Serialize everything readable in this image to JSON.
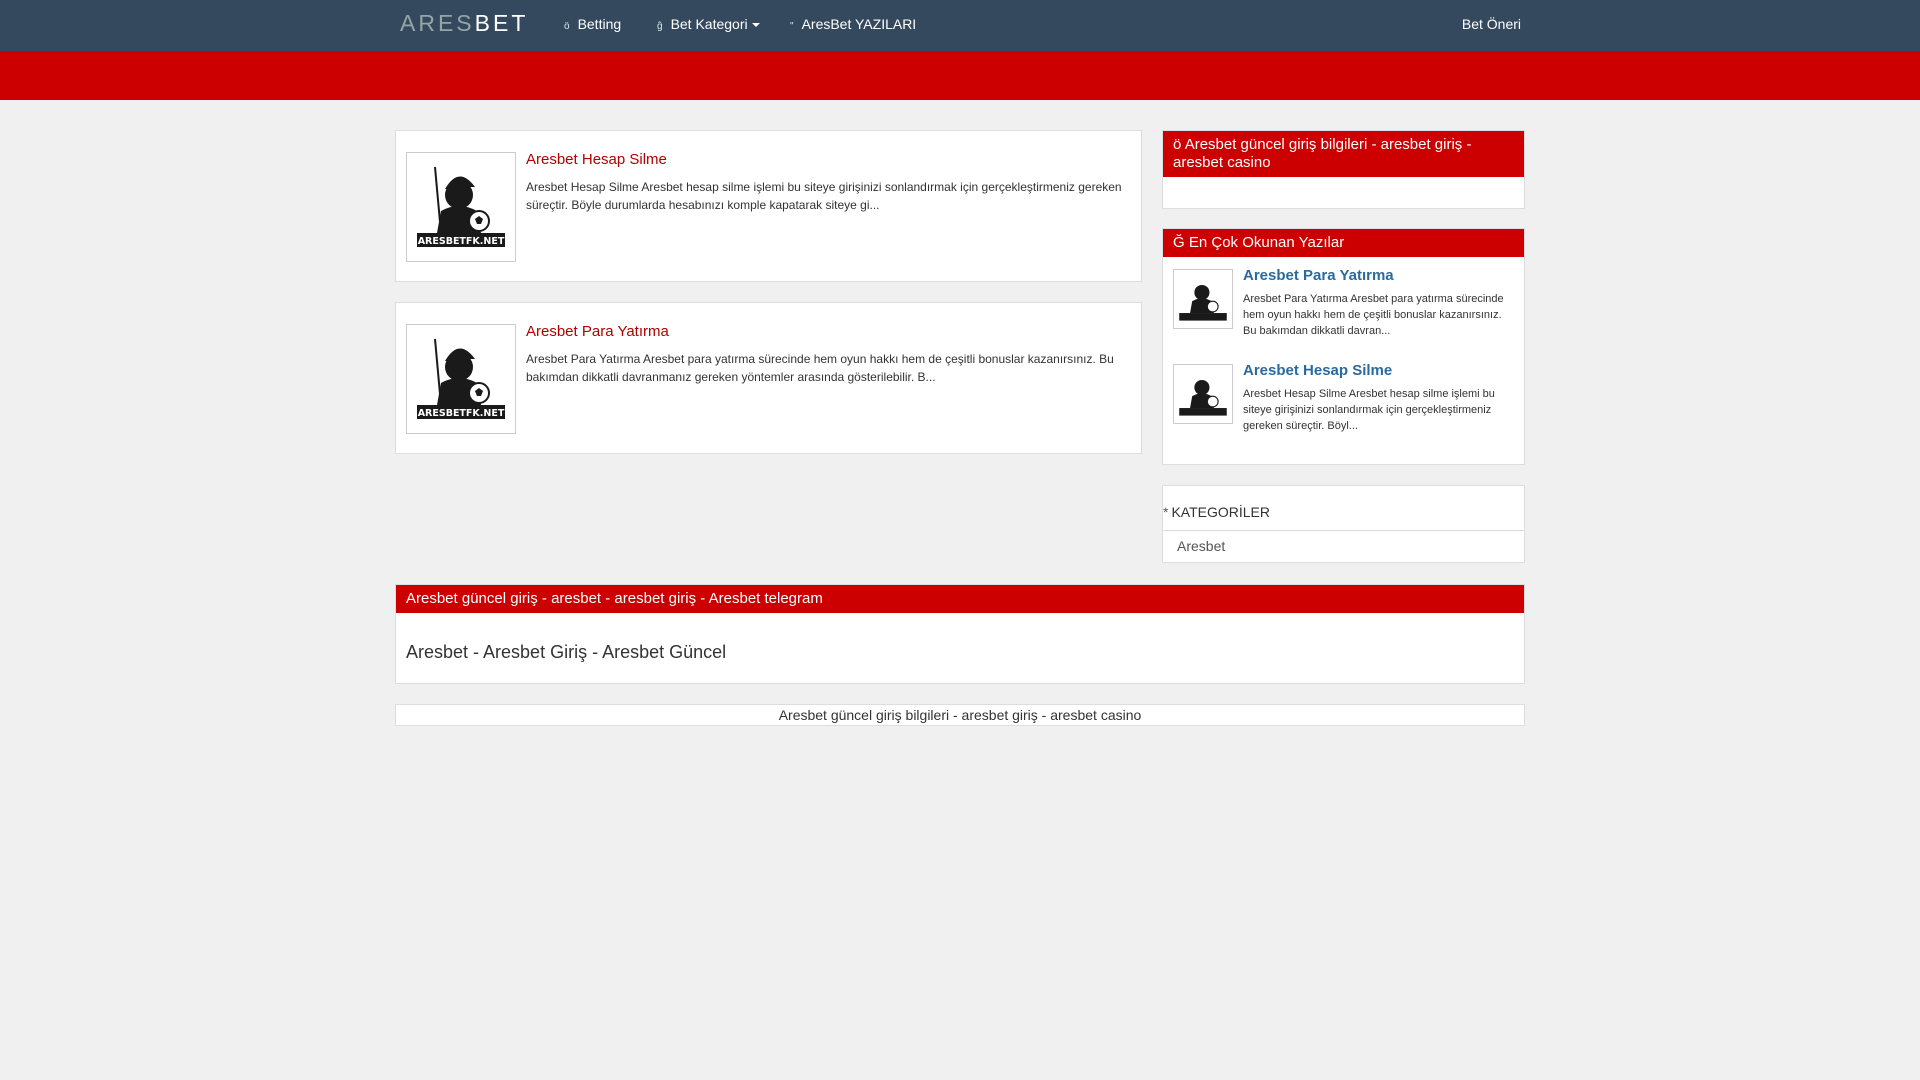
{
  "brand": {
    "part1": "ARES",
    "part2": "BET"
  },
  "nav": {
    "betting": {
      "icon": "home-icon",
      "label": "Betting"
    },
    "kategori": {
      "icon": "list-icon",
      "label": "Bet Kategori"
    },
    "yazilari": {
      "icon": "quote-icon",
      "label": "AresBet YAZILARI"
    },
    "oneri": {
      "icon": "star-icon",
      "label": "Bet Öneri"
    }
  },
  "icon_glyphs": {
    "home": "ö",
    "list": "ĝ",
    "quote": "\"",
    "star": ""
  },
  "posts": [
    {
      "title": "Aresbet Hesap Silme",
      "excerpt": "Aresbet Hesap Silme  Aresbet hesap silme işlemi bu siteye girişinizi sonlandırmak için gerçekleştirmeniz gereken süreçtir. Böyle durumlarda hesabınızı komple kapatarak siteye gi...",
      "logo_text": "ARESBETFK.NET"
    },
    {
      "title": "Aresbet Para Yatırma",
      "excerpt": "Aresbet Para Yatırma Aresbet para yatırma sürecinde hem oyun hakkı hem de çeşitli bonuslar kazanırsınız. Bu bakımdan dikkatli davranmanız gereken yöntemler arasında gösterilebilir. B...",
      "logo_text": "ARESBETFK.NET"
    }
  ],
  "sidebar": {
    "panel1": {
      "icon_glyph": "ö",
      "title": "Aresbet güncel giriş bilgileri - aresbet giriş - aresbet casino"
    },
    "panel2": {
      "icon_glyph": "Ğ",
      "title": "En Çok Okunan Yazılar",
      "items": [
        {
          "title": "Aresbet Para Yatırma",
          "text": "Aresbet Para Yatırma Aresbet para yatırma sürecinde hem oyun hakkı hem de çeşitli bonuslar kazanırsınız. Bu bakımdan dikkatli davran..."
        },
        {
          "title": "Aresbet Hesap Silme",
          "text": "Aresbet Hesap Silme  Aresbet hesap silme işlemi bu siteye girişinizi sonlandırmak için gerçekleştirmeniz gereken süreçtir. Böyl..."
        }
      ]
    },
    "categories": {
      "icon_glyph": "*",
      "title": "KATEGORİLER",
      "items": [
        "Aresbet"
      ]
    }
  },
  "bottom_panel": {
    "header": "Aresbet güncel giriş - aresbet - aresbet giriş - Aresbet telegram",
    "title": "Aresbet - Aresbet Giriş - Aresbet Güncel"
  },
  "footer": {
    "text": "Aresbet güncel giriş bilgileri - aresbet giriş - aresbet casino"
  },
  "colors": {
    "topbar": "#34495e",
    "accent_red": "#cc0000",
    "link_red": "#b30000",
    "link_blue": "#2b6a9e",
    "page_bg": "#f0f0f0"
  }
}
